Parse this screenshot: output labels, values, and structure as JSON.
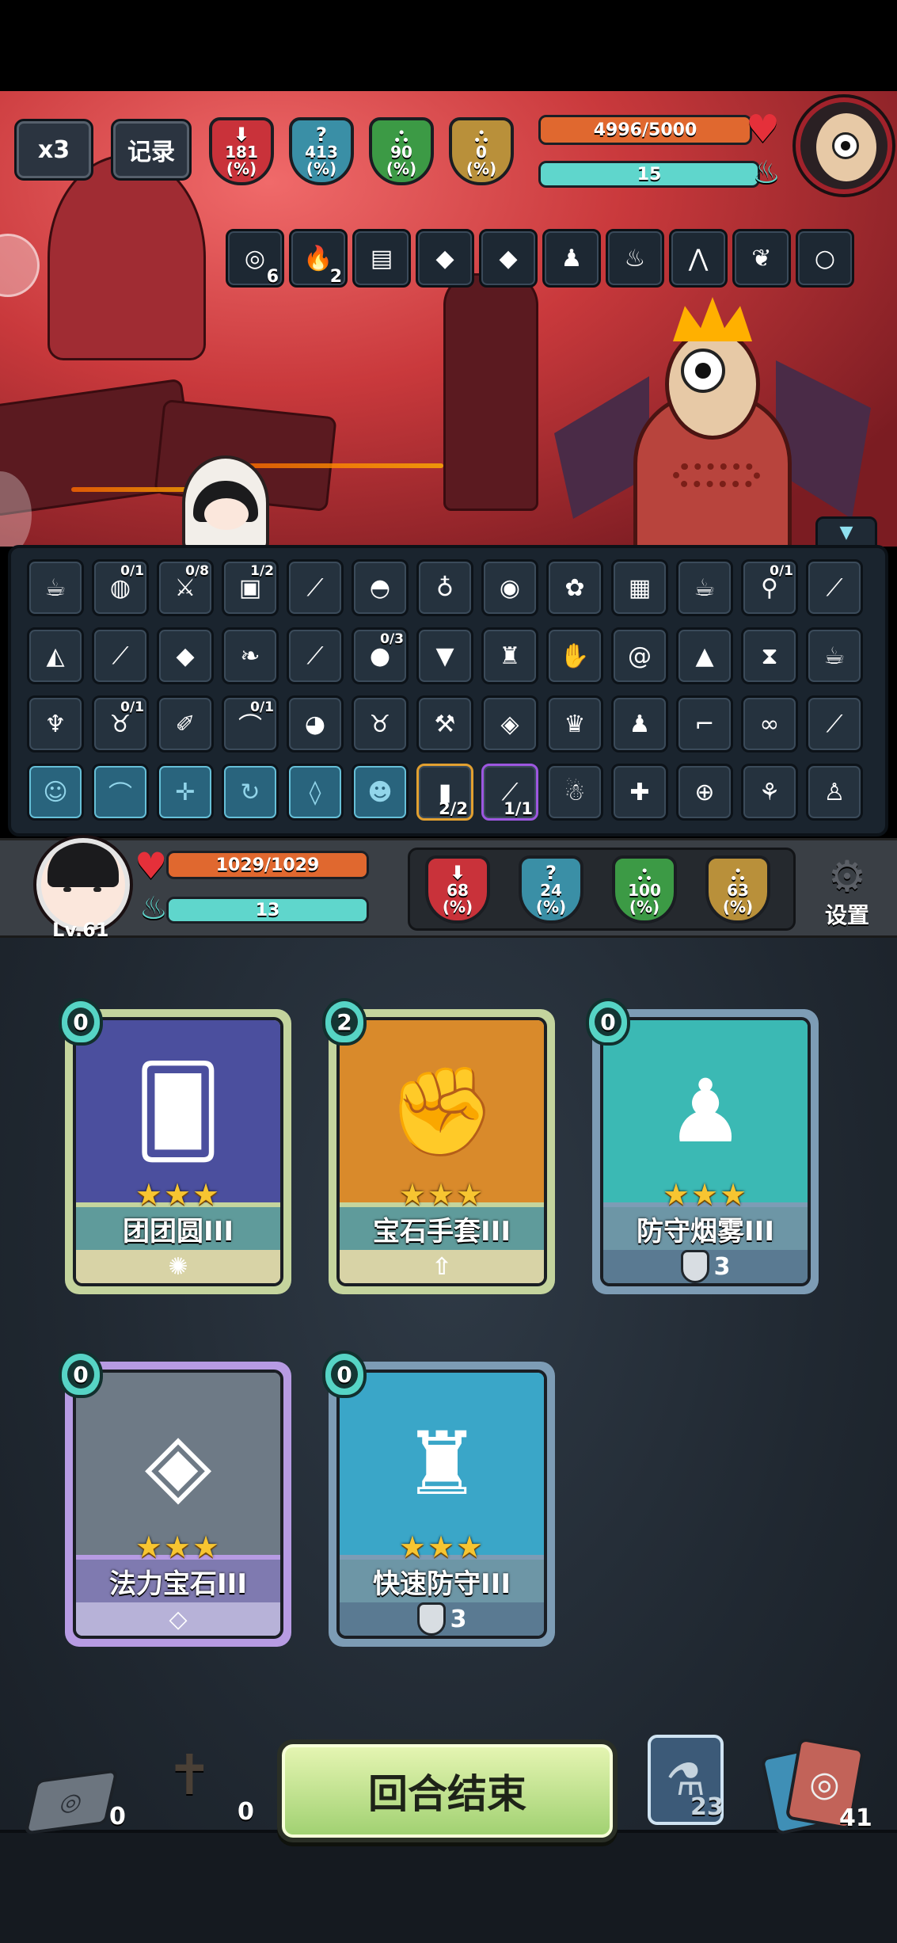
{
  "top": {
    "speed_label": "x3",
    "log_label": "记录",
    "enemy_stats": [
      {
        "value": "181",
        "unit": "(%)",
        "color": "#c9323a",
        "glyph": "⬇"
      },
      {
        "value": "413",
        "unit": "(%)",
        "color": "#3a8fa6",
        "glyph": "?"
      },
      {
        "value": "90",
        "unit": "(%)",
        "color": "#3c9a45",
        "glyph": "⛬"
      },
      {
        "value": "0",
        "unit": "(%)",
        "color": "#b9903a",
        "glyph": "⛬"
      }
    ],
    "enemy_hp": "4996/5000",
    "enemy_hp_fraction": 0.999,
    "enemy_mana": "15",
    "enemy_mana_fraction": 1.0,
    "enemy_relics": [
      {
        "icon": "disc-icon",
        "glyph": "◎",
        "count": "6"
      },
      {
        "icon": "flame-icon",
        "glyph": "🔥",
        "count": "2"
      },
      {
        "icon": "book-icon",
        "glyph": "▤",
        "count": ""
      },
      {
        "icon": "green-gem-icon",
        "glyph": "◆",
        "count": ""
      },
      {
        "icon": "green-gem-icon",
        "glyph": "◆",
        "count": ""
      },
      {
        "icon": "robe-icon",
        "glyph": "♟",
        "count": ""
      },
      {
        "icon": "fire-pot-icon",
        "glyph": "♨",
        "count": ""
      },
      {
        "icon": "claw-icon",
        "glyph": "⋀",
        "count": ""
      },
      {
        "icon": "wing-icon",
        "glyph": "❦",
        "count": ""
      },
      {
        "icon": "beads-icon",
        "glyph": "○",
        "count": ""
      }
    ]
  },
  "inventory": {
    "rows": [
      [
        {
          "icon": "teapot-icon",
          "glyph": "☕",
          "count": ""
        },
        {
          "icon": "galaxy-icon",
          "glyph": "◍",
          "count": "0/1"
        },
        {
          "icon": "dagger-icon",
          "glyph": "⚔",
          "count": "0/8"
        },
        {
          "icon": "camera-icon",
          "glyph": "▣",
          "count": "1/2"
        },
        {
          "icon": "red-staff-icon",
          "glyph": "⟋",
          "count": ""
        },
        {
          "icon": "mask-icon",
          "glyph": "◓",
          "count": ""
        },
        {
          "icon": "bottle-icon",
          "glyph": "♁",
          "count": ""
        },
        {
          "icon": "eye-orb-icon",
          "glyph": "◉",
          "count": ""
        },
        {
          "icon": "rose-icon",
          "glyph": "✿",
          "count": ""
        },
        {
          "icon": "chest-icon",
          "glyph": "▦",
          "count": ""
        },
        {
          "icon": "teapot-icon",
          "glyph": "☕",
          "count": ""
        },
        {
          "icon": "pacifier-icon",
          "glyph": "⚲",
          "count": "0/1"
        },
        {
          "icon": "blue-staff-icon",
          "glyph": "⟋",
          "count": ""
        }
      ],
      [
        {
          "icon": "hat-icon",
          "glyph": "◭",
          "count": ""
        },
        {
          "icon": "yellow-horn-icon",
          "glyph": "⟋",
          "count": ""
        },
        {
          "icon": "green-gem-icon",
          "glyph": "◆",
          "count": ""
        },
        {
          "icon": "wings-icon",
          "glyph": "❧",
          "count": ""
        },
        {
          "icon": "bone-icon",
          "glyph": "⟋",
          "count": ""
        },
        {
          "icon": "red-fruit-icon",
          "glyph": "●",
          "count": "0/3"
        },
        {
          "icon": "ice-cream-icon",
          "glyph": "▼",
          "count": ""
        },
        {
          "icon": "statue-icon",
          "glyph": "♜",
          "count": ""
        },
        {
          "icon": "paw-icon",
          "glyph": "✋",
          "count": ""
        },
        {
          "icon": "fossil-icon",
          "glyph": "@",
          "count": ""
        },
        {
          "icon": "rice-ball-icon",
          "glyph": "▲",
          "count": ""
        },
        {
          "icon": "hourglass-icon",
          "glyph": "⧗",
          "count": ""
        },
        {
          "icon": "cup-icon",
          "glyph": "☕",
          "count": ""
        }
      ],
      [
        {
          "icon": "demon-mask-icon",
          "glyph": "♆",
          "count": ""
        },
        {
          "icon": "sack-icon",
          "glyph": "♉",
          "count": "0/1"
        },
        {
          "icon": "brush-icon",
          "glyph": "✐",
          "count": ""
        },
        {
          "icon": "horn-bow-icon",
          "glyph": "⌒",
          "count": "0/1"
        },
        {
          "icon": "crystal-ball-icon",
          "glyph": "◕",
          "count": ""
        },
        {
          "icon": "pouch-icon",
          "glyph": "♉",
          "count": ""
        },
        {
          "icon": "hammer-icon",
          "glyph": "⚒",
          "count": ""
        },
        {
          "icon": "dark-gem-icon",
          "glyph": "◈",
          "count": ""
        },
        {
          "icon": "trophy-icon",
          "glyph": "♛",
          "count": ""
        },
        {
          "icon": "wizard-icon",
          "glyph": "♟",
          "count": ""
        },
        {
          "icon": "golden-boot-icon",
          "glyph": "⌐",
          "count": ""
        },
        {
          "icon": "goggles-icon",
          "glyph": "∞",
          "count": ""
        },
        {
          "icon": "golden-rod-icon",
          "glyph": "⟋",
          "count": ""
        }
      ],
      [
        {
          "icon": "locked-slot-icon",
          "glyph": "☺",
          "count": "",
          "style": "locked"
        },
        {
          "icon": "locked-bow-icon",
          "glyph": "⌒",
          "count": "",
          "style": "locked"
        },
        {
          "icon": "locked-crossbow-icon",
          "glyph": "✛",
          "count": "",
          "style": "locked"
        },
        {
          "icon": "locked-swirl-icon",
          "glyph": "↻",
          "count": "",
          "style": "locked"
        },
        {
          "icon": "locked-crystal-icon",
          "glyph": "◊",
          "count": "",
          "style": "locked"
        },
        {
          "icon": "locked-face-icon",
          "glyph": "☻",
          "count": "",
          "style": "locked"
        },
        {
          "icon": "gold-scroll-icon",
          "glyph": "▮",
          "count": "2/2",
          "style": "gold"
        },
        {
          "icon": "telescope-icon",
          "glyph": "⟋",
          "count": "1/1",
          "style": "purple"
        },
        {
          "icon": "merchant-icon",
          "glyph": "☃",
          "count": ""
        },
        {
          "icon": "signpost-icon",
          "glyph": "✚",
          "count": ""
        },
        {
          "icon": "compass-icon",
          "glyph": "⊕",
          "count": ""
        },
        {
          "icon": "meat-icon",
          "glyph": "⚘",
          "count": ""
        },
        {
          "icon": "doll-icon",
          "glyph": "♙",
          "count": ""
        }
      ]
    ]
  },
  "player": {
    "level": "Lv.61",
    "hp": "1029/1029",
    "hp_fraction": 1.0,
    "mana": "13",
    "mana_fraction": 1.0,
    "stats": [
      {
        "value": "68",
        "unit": "(%)",
        "color": "#c9323a",
        "glyph": "⬇"
      },
      {
        "value": "24",
        "unit": "(%)",
        "color": "#3a8fa6",
        "glyph": "?"
      },
      {
        "value": "100",
        "unit": "(%)",
        "color": "#3c9a45",
        "glyph": "⛬"
      },
      {
        "value": "63",
        "unit": "(%)",
        "color": "#b9903a",
        "glyph": "⛬"
      }
    ],
    "settings_label": "设置"
  },
  "hand": [
    {
      "name": "团团圆III",
      "cost": "0",
      "stars": "★★★",
      "type": "t-green",
      "art": "🂠",
      "art_bg": "#4b4f9e",
      "foot": "✺",
      "foot_value": ""
    },
    {
      "name": "宝石手套III",
      "cost": "2",
      "stars": "★★★",
      "type": "t-green",
      "art": "✊",
      "art_bg": "#d98a2b",
      "foot": "⇧",
      "foot_value": ""
    },
    {
      "name": "防守烟雾III",
      "cost": "0",
      "stars": "★★★",
      "type": "t-blue",
      "art": "♟",
      "art_bg": "#3bb9b4",
      "foot": "shield",
      "foot_value": "3"
    },
    {
      "name": "法力宝石III",
      "cost": "0",
      "stars": "★★★",
      "type": "t-purple",
      "art": "◈",
      "art_bg": "#6e7a86",
      "foot": "◇",
      "foot_value": ""
    },
    {
      "name": "快速防守III",
      "cost": "0",
      "stars": "★★★",
      "type": "t-blue",
      "art": "♜",
      "art_bg": "#3aa6c8",
      "foot": "shield",
      "foot_value": "3"
    }
  ],
  "bottom": {
    "draw_pile": "0",
    "grave_pile": "0",
    "end_turn": "回合结束",
    "potion_count": "23",
    "deck_count": "41"
  }
}
